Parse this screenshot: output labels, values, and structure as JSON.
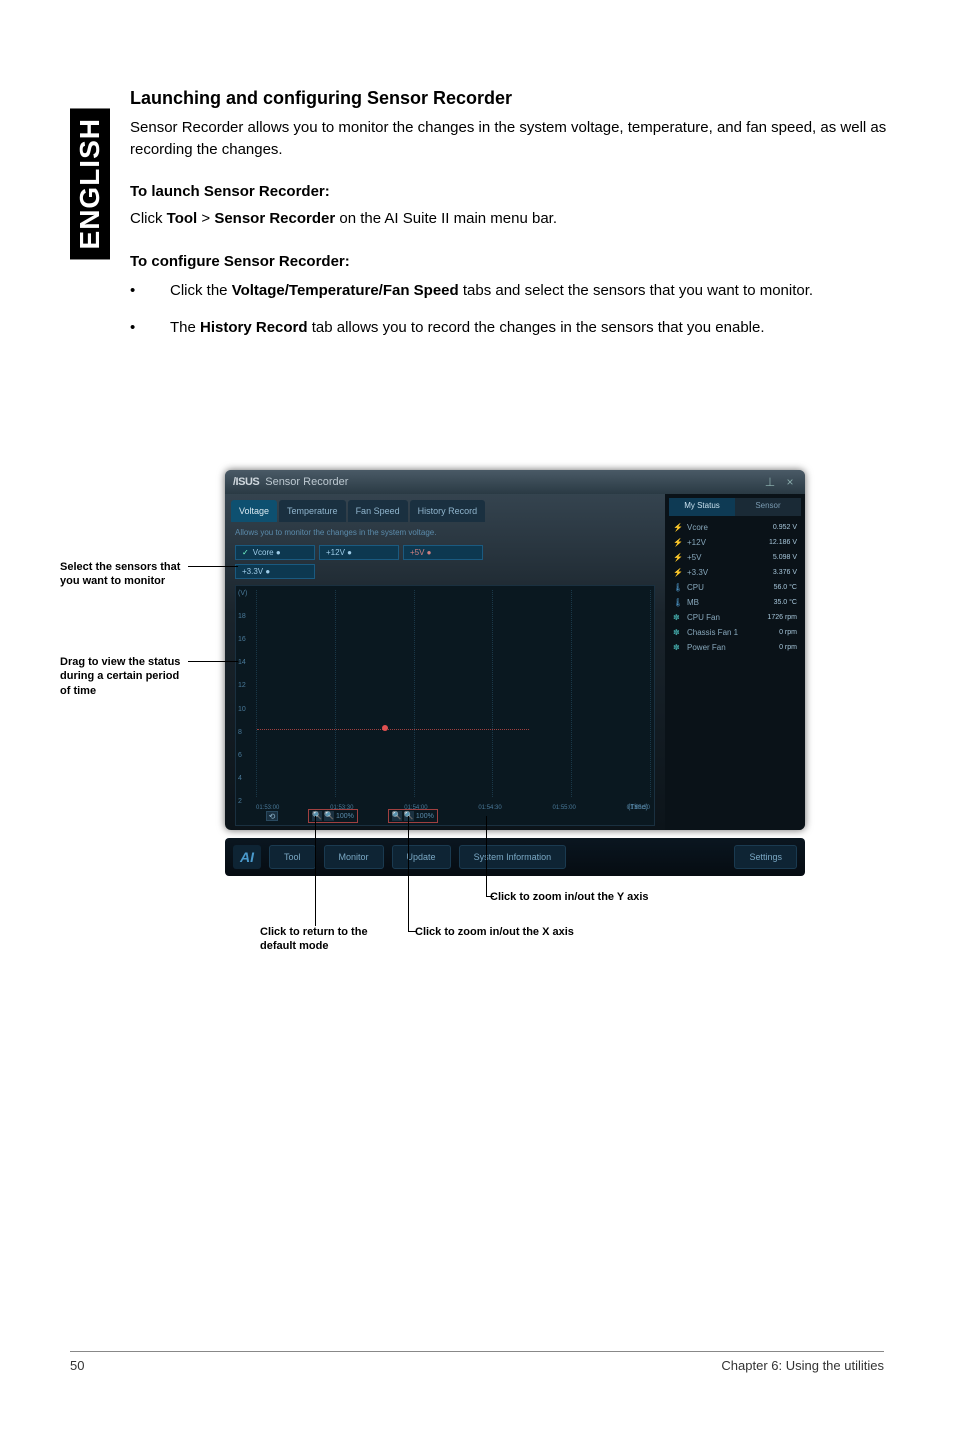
{
  "side_tab": "ENGLISH",
  "heading": "Launching and configuring Sensor Recorder",
  "intro": "Sensor Recorder allows you to monitor the changes in the system voltage, temperature, and fan speed, as well as recording the changes.",
  "launch_heading": "To launch Sensor Recorder:",
  "launch_text_pre": "Click ",
  "launch_text_tool": "Tool",
  "launch_text_gt": " > ",
  "launch_text_sr": "Sensor Recorder",
  "launch_text_post": " on the AI Suite II main menu bar.",
  "config_heading": "To configure Sensor Recorder:",
  "bullets": [
    {
      "pre": "Click the ",
      "bold": "Voltage/Temperature/Fan Speed",
      "post": " tabs and select the sensors that you want to monitor."
    },
    {
      "pre": "The ",
      "bold": "History Record",
      "post": " tab allows you to record the changes in the sensors that you enable."
    }
  ],
  "app": {
    "logo": "/ISUS",
    "title": "Sensor Recorder",
    "tabs": {
      "voltage": "Voltage",
      "temperature": "Temperature",
      "fan_speed": "Fan Speed",
      "history_record": "History Record"
    },
    "hint": "Allows you to monitor the changes in the system voltage.",
    "sensors": {
      "vcore": "Vcore ●",
      "p12v": "+12V ●",
      "p5v": "+5V ●",
      "p3_3v": "+3.3V ●"
    },
    "chart": {
      "y_ticks": [
        "(V)",
        "18",
        "16",
        "14",
        "12",
        "10",
        "8",
        "6",
        "4",
        "2"
      ],
      "x_ticks": [
        "01:53:00",
        "01:53:30",
        "01:54:00",
        "01:54:30",
        "01:55:00",
        "01:55:30"
      ],
      "time_label": "(Time)",
      "zoom_pct": "100%"
    },
    "right_panel": {
      "tab_status": "My Status",
      "tab_sensor": "Sensor",
      "stats": [
        {
          "icon": "⚡",
          "cls": "icon",
          "label": "Vcore",
          "val": "0.952 V"
        },
        {
          "icon": "⚡",
          "cls": "icon",
          "label": "+12V",
          "val": "12.186 V"
        },
        {
          "icon": "⚡",
          "cls": "icon",
          "label": "+5V",
          "val": "5.098 V"
        },
        {
          "icon": "⚡",
          "cls": "icon",
          "label": "+3.3V",
          "val": "3.376 V"
        },
        {
          "icon": "🌡",
          "cls": "icon blue",
          "label": "CPU",
          "val": "56.0 °C"
        },
        {
          "icon": "🌡",
          "cls": "icon blue",
          "label": "MB",
          "val": "35.0 °C"
        },
        {
          "icon": "✽",
          "cls": "icon teal",
          "label": "CPU Fan",
          "val": "1726 rpm"
        },
        {
          "icon": "✽",
          "cls": "icon teal",
          "label": "Chassis Fan 1",
          "val": "0 rpm"
        },
        {
          "icon": "✽",
          "cls": "icon teal",
          "label": "Power Fan",
          "val": "0 rpm"
        }
      ]
    },
    "bottom_bar": {
      "tool": "Tool",
      "monitor": "Monitor",
      "update": "Update",
      "system_info": "System Information",
      "settings": "Settings"
    }
  },
  "callouts": {
    "select_sensors": "Select the sensors that you want to monitor",
    "drag_view": "Drag to view the status during a certain period of time",
    "zoom_y": "Click to zoom in/out the Y axis",
    "zoom_x": "Click to zoom in/out the X axis",
    "return_default": "Click to return to the default mode"
  },
  "footer": {
    "page": "50",
    "chapter": "Chapter 6: Using the utilities"
  }
}
